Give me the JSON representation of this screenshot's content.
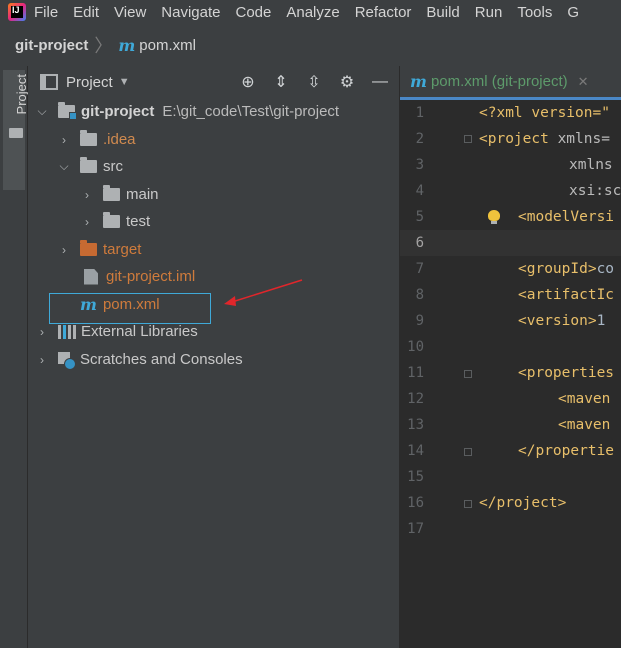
{
  "menubar": {
    "items": [
      "File",
      "Edit",
      "View",
      "Navigate",
      "Code",
      "Analyze",
      "Refactor",
      "Build",
      "Run",
      "Tools",
      "G"
    ]
  },
  "breadcrumb": {
    "project": "git-project",
    "file": "pom.xml"
  },
  "sidebar_strip": {
    "tab_label": "Project"
  },
  "project_panel": {
    "title": "Project",
    "tree": {
      "root_name": "git-project",
      "root_path": "E:\\git_code\\Test\\git-project",
      "idea": ".idea",
      "src": "src",
      "main": "main",
      "test": "test",
      "target": "target",
      "iml": "git-project.iml",
      "pom": "pom.xml",
      "ext_libs": "External Libraries",
      "scratches": "Scratches and Consoles"
    }
  },
  "editor": {
    "tab_label": "pom.xml (git-project)",
    "line_numbers": [
      "1",
      "2",
      "3",
      "4",
      "5",
      "6",
      "7",
      "8",
      "9",
      "10",
      "11",
      "12",
      "13",
      "14",
      "15",
      "16",
      "17"
    ],
    "lines": {
      "l1": "<?xml version=\"",
      "l2a": "<project",
      "l2b": " xmlns=",
      "l3": "xmlns",
      "l4": "xsi:sc",
      "l5": "<modelVersi",
      "l7a": "<groupId>",
      "l7b": "co",
      "l8": "<artifactIc",
      "l9a": "<version>",
      "l9b": "1",
      "l11": "<properties",
      "l12": "<maven",
      "l13": "<maven",
      "l14": "</propertie",
      "l16": "</project>"
    }
  },
  "colors": {
    "accent": "#3fa9d8",
    "annotation_arrow": "#e0262b",
    "tag": "#e8bf6a",
    "tab_text": "#5d9b6b"
  }
}
